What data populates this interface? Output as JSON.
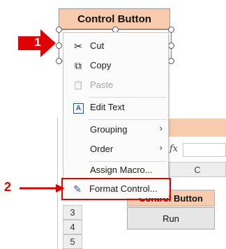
{
  "header": {
    "title": "Control Button"
  },
  "steps": {
    "step1": "1",
    "step2": "2"
  },
  "menu": {
    "items": [
      {
        "label": "Cut",
        "icon": "scissors-icon",
        "glyph": "✂"
      },
      {
        "label": "Copy",
        "icon": "copy-icon",
        "glyph": "⧉"
      },
      {
        "label": "Paste",
        "icon": "paste-icon",
        "glyph": "📋"
      },
      {
        "label": "Edit Text",
        "icon": "edit-text-icon",
        "glyph": "A"
      },
      {
        "label": "Grouping",
        "submenu": "›"
      },
      {
        "label": "Order",
        "submenu": "›"
      },
      {
        "label": "Assign Macro..."
      },
      {
        "label": "Format Control...",
        "icon": "format-control-icon",
        "glyph": "✎"
      }
    ]
  },
  "sheet": {
    "formula_label": "fx",
    "column_c": "C",
    "rows": [
      "3",
      "4",
      "5"
    ],
    "cell_text": "Control Button",
    "run_label": "Run"
  },
  "colors": {
    "accent": "#f8cbad",
    "highlight": "#e00000"
  }
}
